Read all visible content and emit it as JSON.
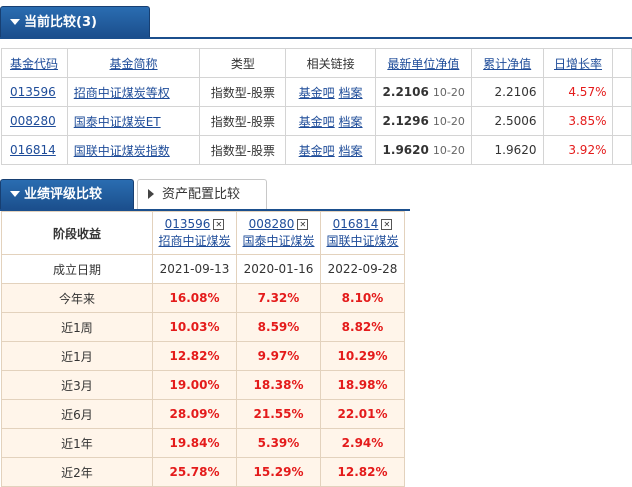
{
  "compare_tab": {
    "label": "当前比较(3)"
  },
  "fund_table": {
    "headers": [
      "基金代码",
      "基金简称",
      "类型",
      "相关链接",
      "最新单位净值",
      "累计净值",
      "日增长率"
    ],
    "rows": [
      {
        "code": "013596",
        "name": "招商中证煤炭等权",
        "type": "指数型-股票",
        "link1": "基金吧",
        "link2": "档案",
        "nav": "2.2106",
        "date": "10-20",
        "acc": "2.2106",
        "rate": "4.57%"
      },
      {
        "code": "008280",
        "name": "国泰中证煤炭ET",
        "type": "指数型-股票",
        "link1": "基金吧",
        "link2": "档案",
        "nav": "2.1296",
        "date": "10-20",
        "acc": "2.5006",
        "rate": "3.85%"
      },
      {
        "code": "016814",
        "name": "国联中证煤炭指数",
        "type": "指数型-股票",
        "link1": "基金吧",
        "link2": "档案",
        "nav": "1.9620",
        "date": "10-20",
        "acc": "1.9620",
        "rate": "3.92%"
      }
    ]
  },
  "tabs2": {
    "perf_label": "业绩评级比较",
    "asset_label": "资产配置比较"
  },
  "perf_table": {
    "corner": "阶段收益",
    "funds": [
      {
        "code": "013596",
        "name": "招商中证煤炭"
      },
      {
        "code": "008280",
        "name": "国泰中证煤炭"
      },
      {
        "code": "016814",
        "name": "国联中证煤炭"
      }
    ],
    "rows": [
      {
        "label": "成立日期",
        "values": [
          "2021-09-13",
          "2020-01-16",
          "2022-09-28"
        ]
      },
      {
        "label": "今年来",
        "values": [
          "16.08%",
          "7.32%",
          "8.10%"
        ]
      },
      {
        "label": "近1周",
        "values": [
          "10.03%",
          "8.59%",
          "8.82%"
        ]
      },
      {
        "label": "近1月",
        "values": [
          "12.82%",
          "9.97%",
          "10.29%"
        ]
      },
      {
        "label": "近3月",
        "values": [
          "19.00%",
          "18.38%",
          "18.98%"
        ]
      },
      {
        "label": "近6月",
        "values": [
          "28.09%",
          "21.55%",
          "22.01%"
        ]
      },
      {
        "label": "近1年",
        "values": [
          "19.84%",
          "5.39%",
          "2.94%"
        ]
      },
      {
        "label": "近2年",
        "values": [
          "25.78%",
          "15.29%",
          "12.82%"
        ]
      }
    ]
  },
  "colors": {
    "tab_blue": "#1b4f8d",
    "link_blue": "#1e4c99",
    "up_red": "#e41b1b",
    "row_tint": "#fff5ea"
  }
}
